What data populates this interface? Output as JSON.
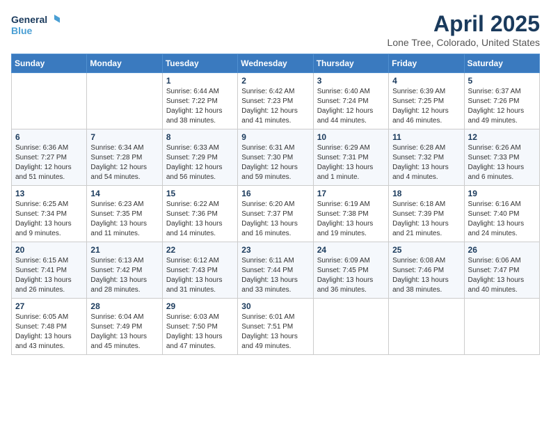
{
  "header": {
    "logo_line1": "General",
    "logo_line2": "Blue",
    "month_title": "April 2025",
    "location": "Lone Tree, Colorado, United States"
  },
  "days_of_week": [
    "Sunday",
    "Monday",
    "Tuesday",
    "Wednesday",
    "Thursday",
    "Friday",
    "Saturday"
  ],
  "weeks": [
    [
      {
        "day": "",
        "info": ""
      },
      {
        "day": "",
        "info": ""
      },
      {
        "day": "1",
        "info": "Sunrise: 6:44 AM\nSunset: 7:22 PM\nDaylight: 12 hours and 38 minutes."
      },
      {
        "day": "2",
        "info": "Sunrise: 6:42 AM\nSunset: 7:23 PM\nDaylight: 12 hours and 41 minutes."
      },
      {
        "day": "3",
        "info": "Sunrise: 6:40 AM\nSunset: 7:24 PM\nDaylight: 12 hours and 44 minutes."
      },
      {
        "day": "4",
        "info": "Sunrise: 6:39 AM\nSunset: 7:25 PM\nDaylight: 12 hours and 46 minutes."
      },
      {
        "day": "5",
        "info": "Sunrise: 6:37 AM\nSunset: 7:26 PM\nDaylight: 12 hours and 49 minutes."
      }
    ],
    [
      {
        "day": "6",
        "info": "Sunrise: 6:36 AM\nSunset: 7:27 PM\nDaylight: 12 hours and 51 minutes."
      },
      {
        "day": "7",
        "info": "Sunrise: 6:34 AM\nSunset: 7:28 PM\nDaylight: 12 hours and 54 minutes."
      },
      {
        "day": "8",
        "info": "Sunrise: 6:33 AM\nSunset: 7:29 PM\nDaylight: 12 hours and 56 minutes."
      },
      {
        "day": "9",
        "info": "Sunrise: 6:31 AM\nSunset: 7:30 PM\nDaylight: 12 hours and 59 minutes."
      },
      {
        "day": "10",
        "info": "Sunrise: 6:29 AM\nSunset: 7:31 PM\nDaylight: 13 hours and 1 minute."
      },
      {
        "day": "11",
        "info": "Sunrise: 6:28 AM\nSunset: 7:32 PM\nDaylight: 13 hours and 4 minutes."
      },
      {
        "day": "12",
        "info": "Sunrise: 6:26 AM\nSunset: 7:33 PM\nDaylight: 13 hours and 6 minutes."
      }
    ],
    [
      {
        "day": "13",
        "info": "Sunrise: 6:25 AM\nSunset: 7:34 PM\nDaylight: 13 hours and 9 minutes."
      },
      {
        "day": "14",
        "info": "Sunrise: 6:23 AM\nSunset: 7:35 PM\nDaylight: 13 hours and 11 minutes."
      },
      {
        "day": "15",
        "info": "Sunrise: 6:22 AM\nSunset: 7:36 PM\nDaylight: 13 hours and 14 minutes."
      },
      {
        "day": "16",
        "info": "Sunrise: 6:20 AM\nSunset: 7:37 PM\nDaylight: 13 hours and 16 minutes."
      },
      {
        "day": "17",
        "info": "Sunrise: 6:19 AM\nSunset: 7:38 PM\nDaylight: 13 hours and 19 minutes."
      },
      {
        "day": "18",
        "info": "Sunrise: 6:18 AM\nSunset: 7:39 PM\nDaylight: 13 hours and 21 minutes."
      },
      {
        "day": "19",
        "info": "Sunrise: 6:16 AM\nSunset: 7:40 PM\nDaylight: 13 hours and 24 minutes."
      }
    ],
    [
      {
        "day": "20",
        "info": "Sunrise: 6:15 AM\nSunset: 7:41 PM\nDaylight: 13 hours and 26 minutes."
      },
      {
        "day": "21",
        "info": "Sunrise: 6:13 AM\nSunset: 7:42 PM\nDaylight: 13 hours and 28 minutes."
      },
      {
        "day": "22",
        "info": "Sunrise: 6:12 AM\nSunset: 7:43 PM\nDaylight: 13 hours and 31 minutes."
      },
      {
        "day": "23",
        "info": "Sunrise: 6:11 AM\nSunset: 7:44 PM\nDaylight: 13 hours and 33 minutes."
      },
      {
        "day": "24",
        "info": "Sunrise: 6:09 AM\nSunset: 7:45 PM\nDaylight: 13 hours and 36 minutes."
      },
      {
        "day": "25",
        "info": "Sunrise: 6:08 AM\nSunset: 7:46 PM\nDaylight: 13 hours and 38 minutes."
      },
      {
        "day": "26",
        "info": "Sunrise: 6:06 AM\nSunset: 7:47 PM\nDaylight: 13 hours and 40 minutes."
      }
    ],
    [
      {
        "day": "27",
        "info": "Sunrise: 6:05 AM\nSunset: 7:48 PM\nDaylight: 13 hours and 43 minutes."
      },
      {
        "day": "28",
        "info": "Sunrise: 6:04 AM\nSunset: 7:49 PM\nDaylight: 13 hours and 45 minutes."
      },
      {
        "day": "29",
        "info": "Sunrise: 6:03 AM\nSunset: 7:50 PM\nDaylight: 13 hours and 47 minutes."
      },
      {
        "day": "30",
        "info": "Sunrise: 6:01 AM\nSunset: 7:51 PM\nDaylight: 13 hours and 49 minutes."
      },
      {
        "day": "",
        "info": ""
      },
      {
        "day": "",
        "info": ""
      },
      {
        "day": "",
        "info": ""
      }
    ]
  ]
}
